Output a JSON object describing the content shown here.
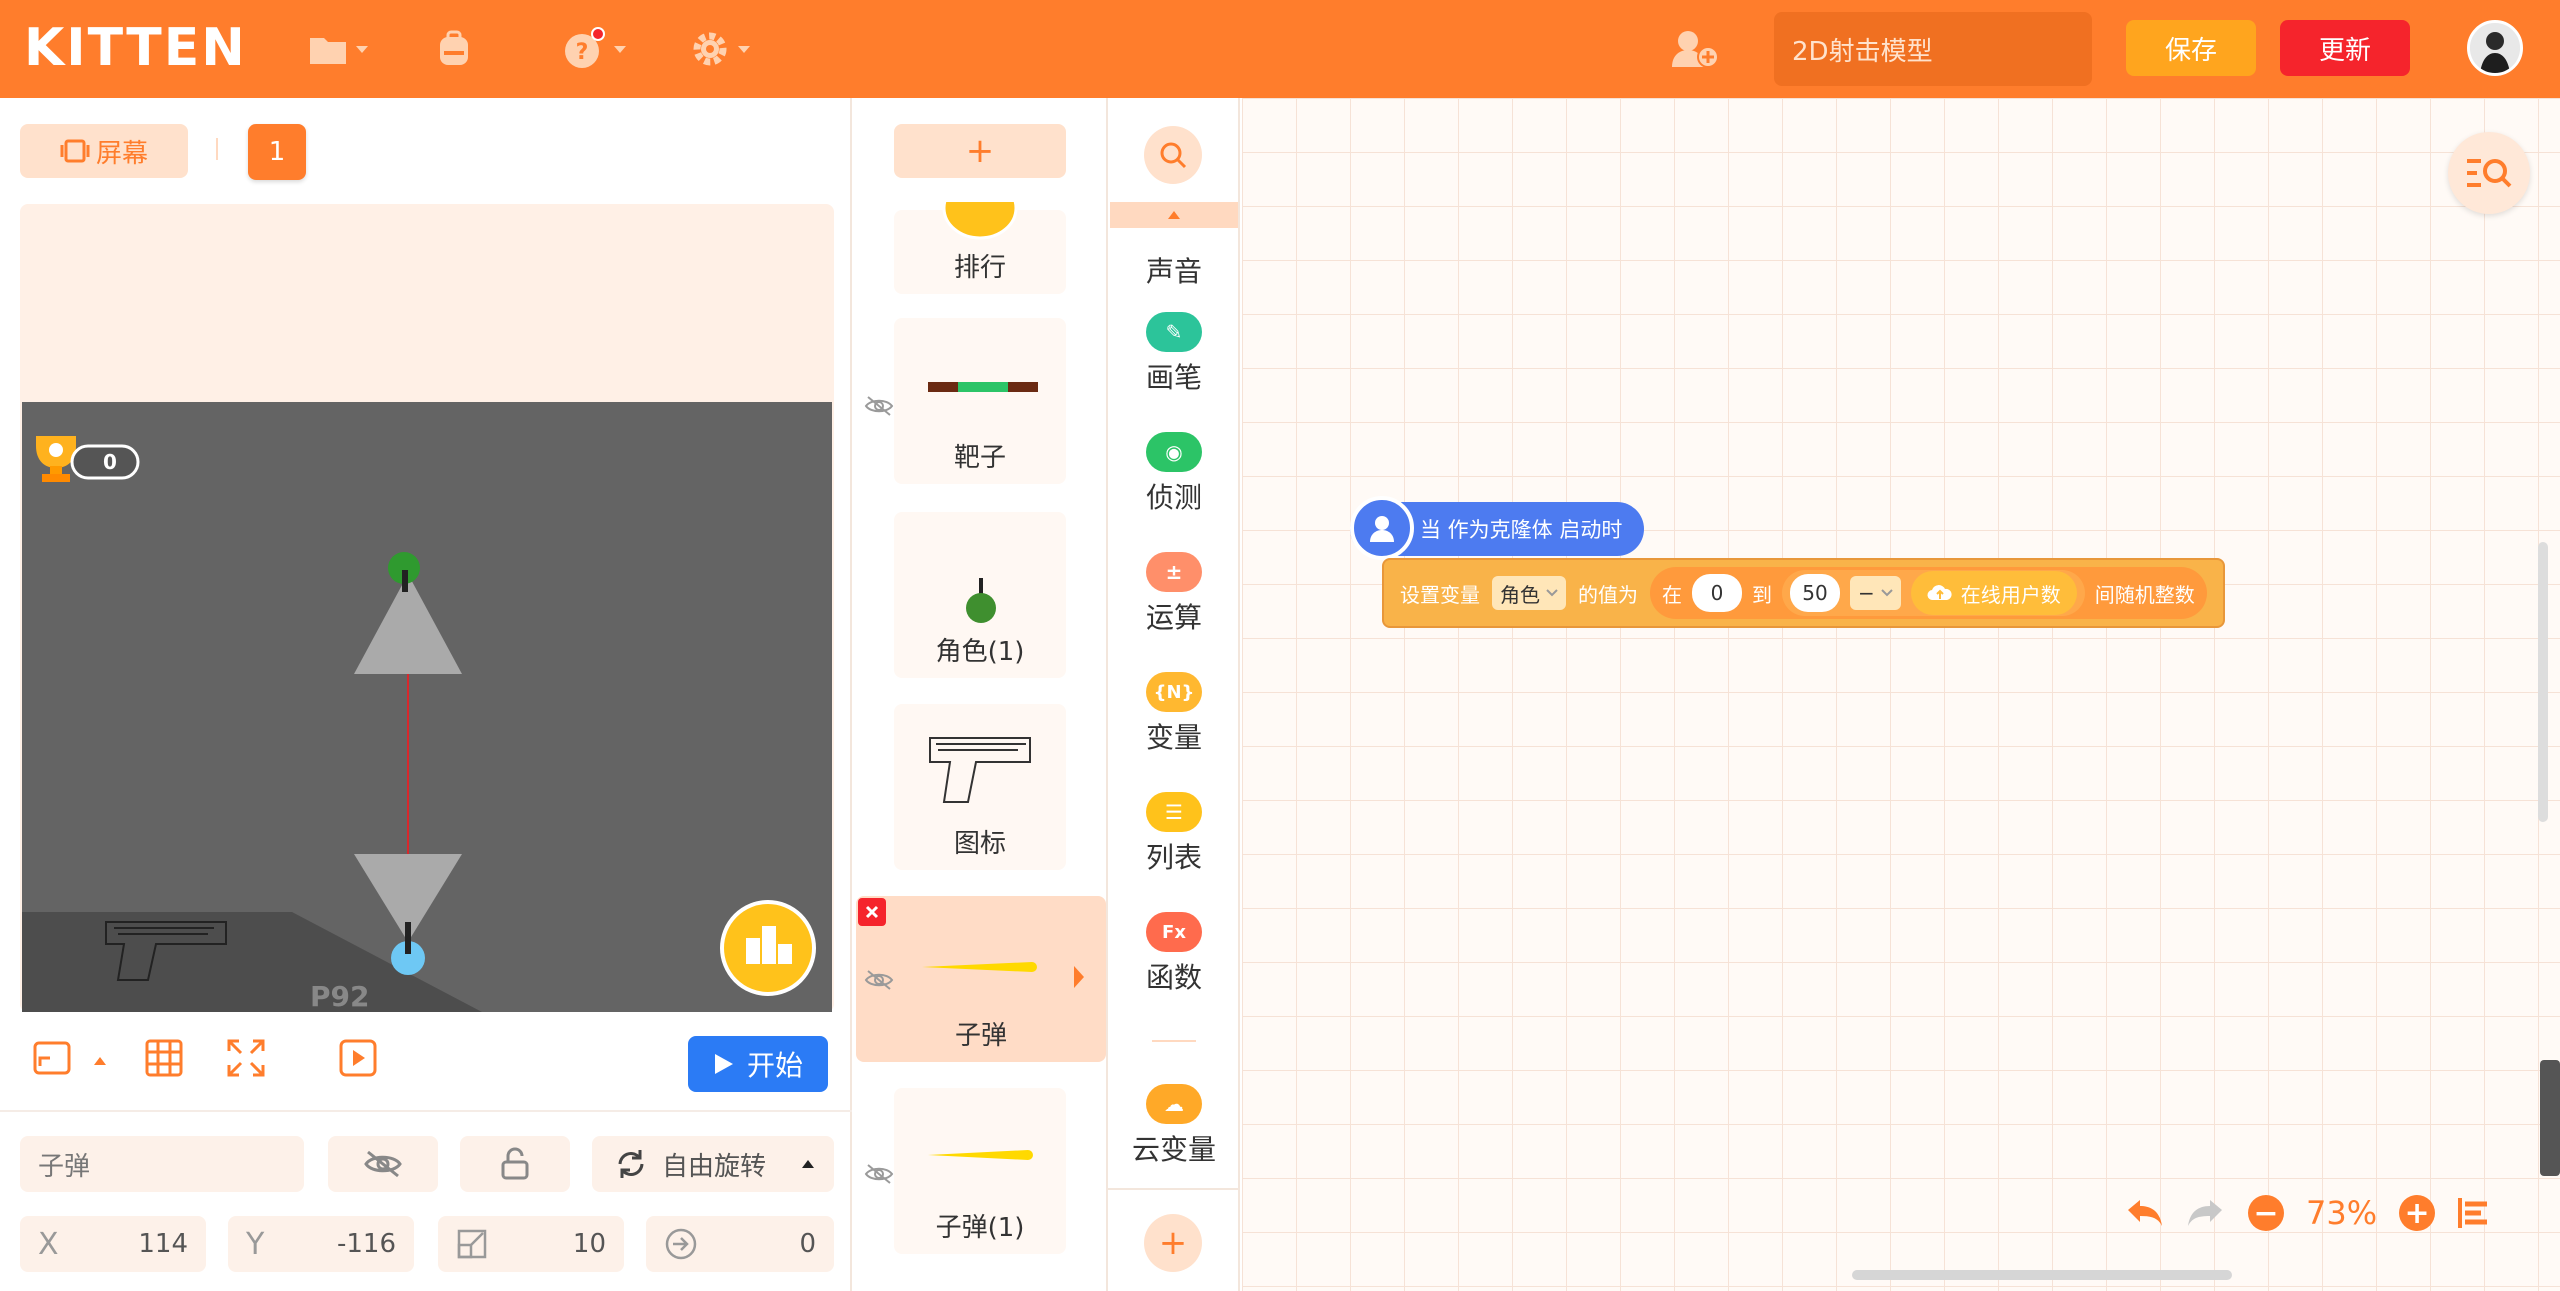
{
  "app": {
    "logo": "KITTEN",
    "project_name": "2D射击模型",
    "save_label": "保存",
    "update_label": "更新"
  },
  "stage": {
    "screen_label": "屏幕",
    "screen_number": "1",
    "score": "0",
    "gun_text": "P92",
    "start_label": "开始"
  },
  "sprite_props": {
    "name": "子弹",
    "rotation_mode": "自由旋转",
    "x_label": "X",
    "x": "114",
    "y_label": "Y",
    "y": "-116",
    "size": "10",
    "direction": "0"
  },
  "sprites": [
    {
      "label": "排行"
    },
    {
      "label": "靶子"
    },
    {
      "label": "角色(1)"
    },
    {
      "label": "图标"
    },
    {
      "label": "子弹"
    },
    {
      "label": "子弹(1)"
    }
  ],
  "categories": [
    {
      "label": "声音",
      "color": "#a879f5",
      "icon": "sound-icon"
    },
    {
      "label": "画笔",
      "color": "#2cc49a",
      "icon": "pen-icon"
    },
    {
      "label": "侦测",
      "color": "#2cc467",
      "icon": "sensing-icon"
    },
    {
      "label": "运算",
      "color": "#ff8f6a",
      "icon": "operator-icon"
    },
    {
      "label": "变量",
      "color": "#ffb830",
      "icon": "variable-icon"
    },
    {
      "label": "列表",
      "color": "#ffc21b",
      "icon": "list-icon"
    },
    {
      "label": "函数",
      "color": "#ff6b4d",
      "icon": "function-icon"
    },
    {
      "label": "云变量",
      "color": "#ffa928",
      "icon": "cloud-variable-icon"
    }
  ],
  "blocks": {
    "hat_label": "当 作为克隆体 启动时",
    "set_var_prefix": "设置变量",
    "var_name": "角色",
    "set_var_mid": "的值为",
    "rand_from": "在",
    "rand_min": "0",
    "rand_to": "到",
    "rand_a": "50",
    "operator": "−",
    "online_users": "在线用户数",
    "rand_suffix": "间随机整数"
  },
  "workspace": {
    "zoom": "73%"
  }
}
